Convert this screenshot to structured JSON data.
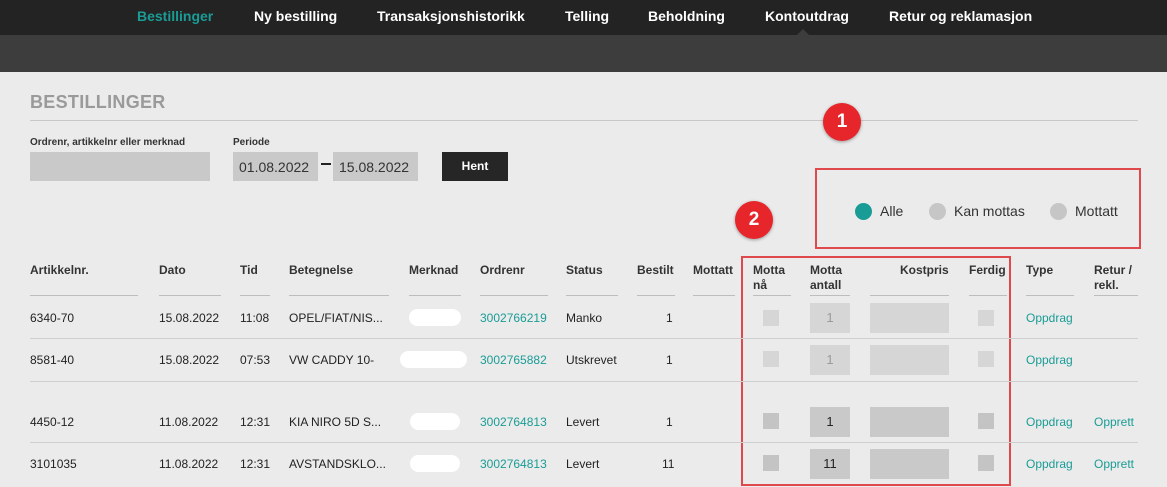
{
  "nav": {
    "items": [
      {
        "label": "Bestillinger"
      },
      {
        "label": "Ny bestilling"
      },
      {
        "label": "Transaksjonshistorikk"
      },
      {
        "label": "Telling"
      },
      {
        "label": "Beholdning"
      },
      {
        "label": "Kontoutdrag"
      },
      {
        "label": "Retur og reklamasjon"
      }
    ],
    "active_index": 0,
    "active_color": "#1a9c96"
  },
  "page": {
    "title": "BESTILLINGER"
  },
  "search": {
    "label": "Ordrenr, artikkelnr eller merknad",
    "value": "",
    "periode_label": "Periode",
    "from_date": "01.08.2022",
    "to_date": "15.08.2022",
    "button_label": "Hent"
  },
  "filter": {
    "options": [
      {
        "label": "Alle",
        "selected": true
      },
      {
        "label": "Kan mottas",
        "selected": false
      },
      {
        "label": "Mottatt",
        "selected": false
      }
    ]
  },
  "annotations": {
    "badge1": "1",
    "badge2": "2",
    "highlight_color": "#e0494b"
  },
  "table": {
    "headers": {
      "artikkelnr": "Artikkelnr.",
      "dato": "Dato",
      "tid": "Tid",
      "betegnelse": "Betegnelse",
      "merknad": "Merknad",
      "ordrenr": "Ordrenr",
      "status": "Status",
      "bestilt": "Bestilt",
      "mottatt": "Mottatt",
      "motta_na_1": "Motta",
      "motta_na_2": "nå",
      "motta_antall_1": "Motta",
      "motta_antall_2": "antall",
      "kostpris": "Kostpris",
      "ferdig": "Ferdig",
      "type": "Type",
      "retur_1": "Retur /",
      "retur_2": "rekl."
    },
    "rows": [
      {
        "artikkelnr": "6340-70",
        "dato": "15.08.2022",
        "tid": "11:08",
        "betegnelse": "OPEL/FIAT/NIS...",
        "ordrenr": "3002766219",
        "status": "Manko",
        "bestilt": "1",
        "motta_antall": "1",
        "editable": false,
        "type": "Oppdrag",
        "retur": ""
      },
      {
        "artikkelnr": "8581-40",
        "dato": "15.08.2022",
        "tid": "07:53",
        "betegnelse": "VW CADDY 10-",
        "ordrenr": "3002765882",
        "status": "Utskrevet",
        "bestilt": "1",
        "motta_antall": "1",
        "editable": false,
        "type": "Oppdrag",
        "retur": ""
      },
      {
        "artikkelnr": "4450-12",
        "dato": "11.08.2022",
        "tid": "12:31",
        "betegnelse": "KIA NIRO 5D S...",
        "ordrenr": "3002764813",
        "status": "Levert",
        "bestilt": "1",
        "motta_antall": "1",
        "editable": true,
        "type": "Oppdrag",
        "retur": "Opprett"
      },
      {
        "artikkelnr": "3101035",
        "dato": "11.08.2022",
        "tid": "12:31",
        "betegnelse": "AVSTANDSKLO...",
        "ordrenr": "3002764813",
        "status": "Levert",
        "bestilt": "11",
        "motta_antall": "11",
        "editable": true,
        "type": "Oppdrag",
        "retur": "Opprett"
      }
    ]
  }
}
